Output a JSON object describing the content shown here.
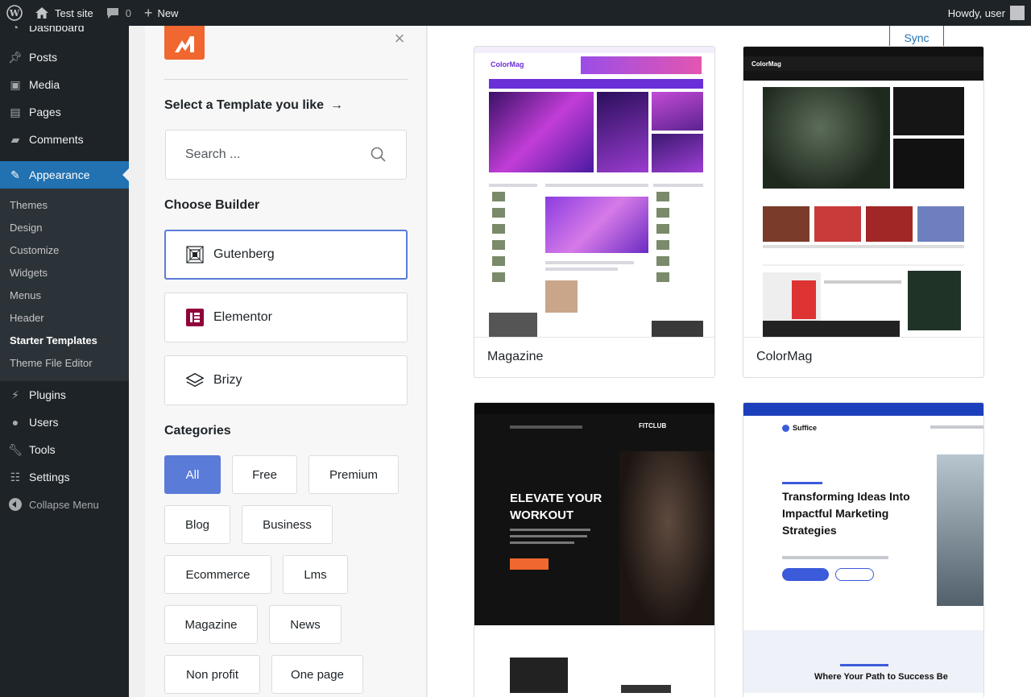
{
  "adminbar": {
    "site_name": "Test site",
    "comments_count": "0",
    "new_label": "New",
    "howdy": "Howdy, user"
  },
  "sidebar": {
    "items_top": [
      {
        "label": "Dashboard",
        "icon": "dashboard-icon"
      },
      {
        "label": "Posts",
        "icon": "pushpin-icon"
      },
      {
        "label": "Media",
        "icon": "media-icon"
      },
      {
        "label": "Pages",
        "icon": "pages-icon"
      },
      {
        "label": "Comments",
        "icon": "comment-icon"
      }
    ],
    "current": {
      "label": "Appearance",
      "icon": "brush-icon"
    },
    "submenu": [
      "Themes",
      "Design",
      "Customize",
      "Widgets",
      "Menus",
      "Header",
      "Starter Templates",
      "Theme File Editor"
    ],
    "submenu_active": "Starter Templates",
    "items_bottom": [
      {
        "label": "Plugins",
        "icon": "plugin-icon"
      },
      {
        "label": "Users",
        "icon": "users-icon"
      },
      {
        "label": "Tools",
        "icon": "wrench-icon"
      },
      {
        "label": "Settings",
        "icon": "settings-icon"
      }
    ],
    "collapse": "Collapse Menu"
  },
  "panel": {
    "select_title": "Select a Template you like",
    "search_placeholder": "Search ...",
    "choose_builder": "Choose Builder",
    "builders": [
      {
        "label": "Gutenberg",
        "icon": "gutenberg-icon",
        "selected": true
      },
      {
        "label": "Elementor",
        "icon": "elementor-icon",
        "selected": false
      },
      {
        "label": "Brizy",
        "icon": "brizy-icon",
        "selected": false
      }
    ],
    "categories_title": "Categories",
    "categories": [
      "All",
      "Free",
      "Premium",
      "Blog",
      "Business",
      "Ecommerce",
      "Lms",
      "Magazine",
      "News",
      "Non profit",
      "One page"
    ],
    "active_category": "All"
  },
  "main": {
    "sync_label": "Sync",
    "templates": [
      {
        "name": "Magazine",
        "thumb_text": "ColorMag"
      },
      {
        "name": "ColorMag",
        "thumb_text": "ColorMag"
      },
      {
        "name": "",
        "thumb_text": "ELEVATE YOUR WORKOUT"
      },
      {
        "name": "",
        "thumb_text": "Transforming Ideas Into Impactful Marketing Strategies"
      }
    ],
    "fit_brand": "FITCLUB",
    "suffice_brand": "Suffice",
    "suffice_bottom": "Where Your Path to Success Be"
  },
  "colors": {
    "accent": "#2271b1",
    "category_active": "#5a7bd8",
    "astra_orange": "#f0672f",
    "admin_dark": "#1d2327"
  }
}
